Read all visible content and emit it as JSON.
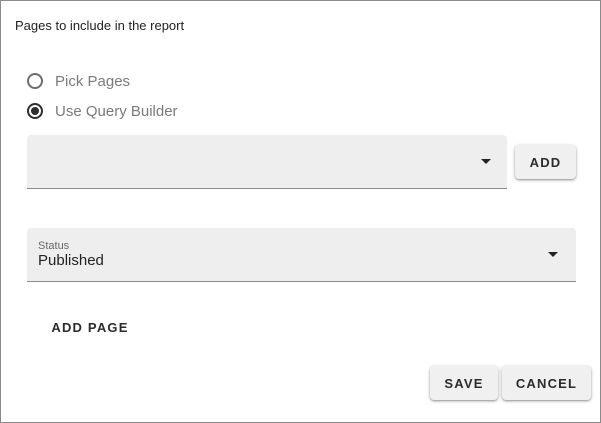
{
  "dialog": {
    "section_title": "Pages to include in the report",
    "selection_mode": {
      "options": [
        {
          "label": "Pick Pages",
          "checked": false
        },
        {
          "label": "Use Query Builder",
          "checked": true
        }
      ]
    },
    "query_select": {
      "value": "",
      "add_label": "ADD"
    },
    "status_select": {
      "label": "Status",
      "value": "Published"
    },
    "add_page_label": "ADD PAGE",
    "actions": {
      "save_label": "SAVE",
      "cancel_label": "CANCEL"
    }
  }
}
